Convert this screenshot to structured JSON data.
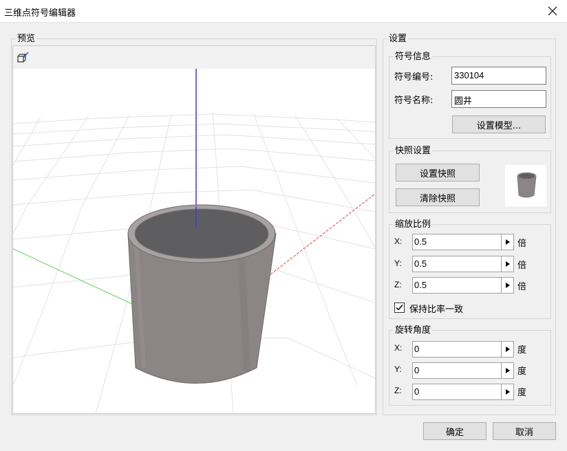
{
  "window": {
    "title": "三维点符号编辑器"
  },
  "preview": {
    "label": "预览"
  },
  "settings": {
    "label": "设置",
    "symbol_info": {
      "label": "符号信息",
      "code_label": "符号编号:",
      "code_value": "330104",
      "name_label": "符号名称:",
      "name_value": "圆井",
      "set_model_button": "设置模型..."
    },
    "snapshot": {
      "label": "快照设置",
      "set_button": "设置快照",
      "clear_button": "清除快照"
    },
    "scale": {
      "label": "缩放比例",
      "x_label": "X:",
      "x_value": "0.5",
      "y_label": "Y:",
      "y_value": "0.5",
      "z_label": "Z:",
      "z_value": "0.5",
      "unit": "倍",
      "keep_ratio_label": "保持比率一致",
      "keep_ratio_checked": true
    },
    "rotation": {
      "label": "旋转角度",
      "x_label": "X:",
      "x_value": "0",
      "y_label": "Y:",
      "y_value": "0",
      "z_label": "Z:",
      "z_value": "0",
      "unit": "度"
    }
  },
  "footer": {
    "ok_button": "确定",
    "cancel_button": "取消"
  },
  "icons": {
    "close": "close-icon",
    "view_tool": "view-cube-icon",
    "spin_arrow": "triangle-right-icon",
    "check": "checkmark-icon"
  },
  "colors": {
    "z_axis": "#3b3bd9",
    "x_axis": "#e04545",
    "y_axis": "#5fd35f",
    "model": "#8b8585",
    "model_top": "#5e5e60"
  }
}
